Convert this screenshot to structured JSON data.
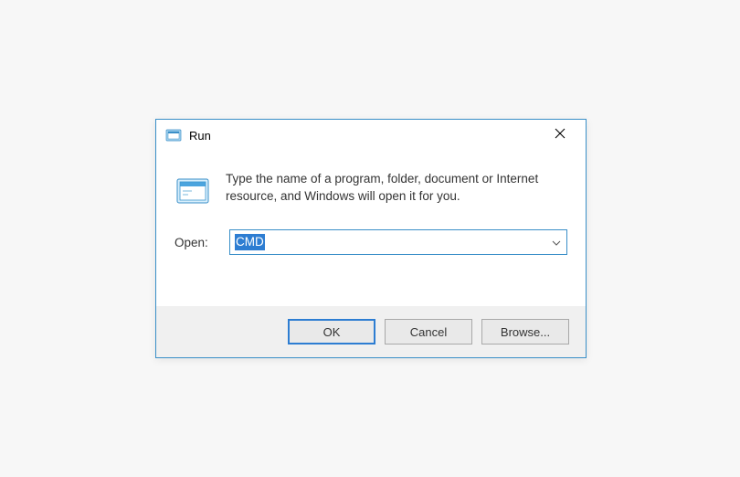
{
  "dialog": {
    "title": "Run",
    "info_text": "Type the name of a program, folder, document or Internet resource, and Windows will open it for you.",
    "open_label": "Open:",
    "open_value": "CMD",
    "buttons": {
      "ok": "OK",
      "cancel": "Cancel",
      "browse": "Browse..."
    }
  }
}
